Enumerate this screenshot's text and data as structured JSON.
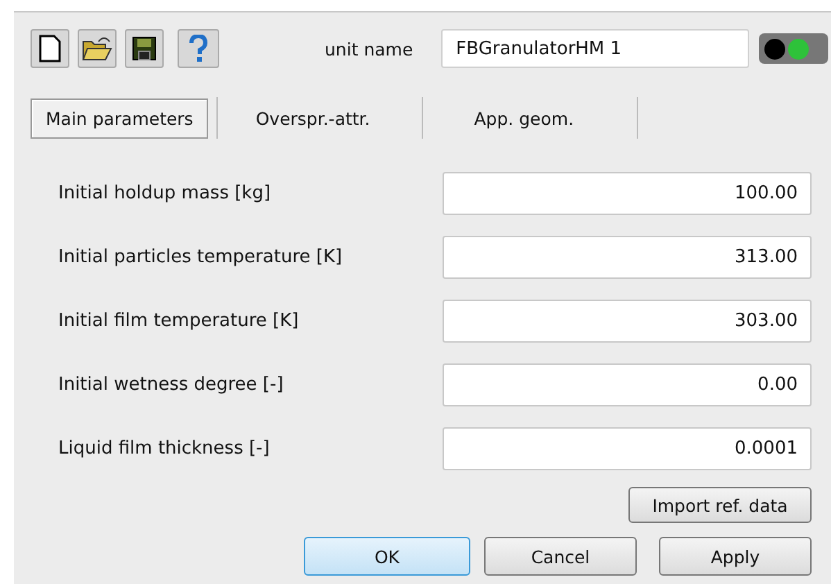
{
  "toolbar": {
    "unit_name_label": "unit name",
    "unit_name": "FBGranulatorHM 1",
    "status_light": {
      "on": true
    }
  },
  "tabs": [
    {
      "label": "Main parameters",
      "selected": true
    },
    {
      "label": "Overspr.-attr.",
      "selected": false
    },
    {
      "label": "App. geom.",
      "selected": false
    }
  ],
  "parameters": [
    {
      "label": "Initial holdup mass [kg]",
      "value": "100.00"
    },
    {
      "label": "Initial particles temperature [K]",
      "value": "313.00"
    },
    {
      "label": "Initial film temperature [K]",
      "value": "303.00"
    },
    {
      "label": "Initial wetness degree  [-]",
      "value": "0.00"
    },
    {
      "label": "Liquid film thickness [-]",
      "value": "0.0001"
    }
  ],
  "import_button": "Import ref. data",
  "buttons": [
    {
      "label": "OK",
      "kind": "default"
    },
    {
      "label": "Cancel",
      "kind": "normal"
    },
    {
      "label": "Apply",
      "kind": "normal"
    }
  ]
}
